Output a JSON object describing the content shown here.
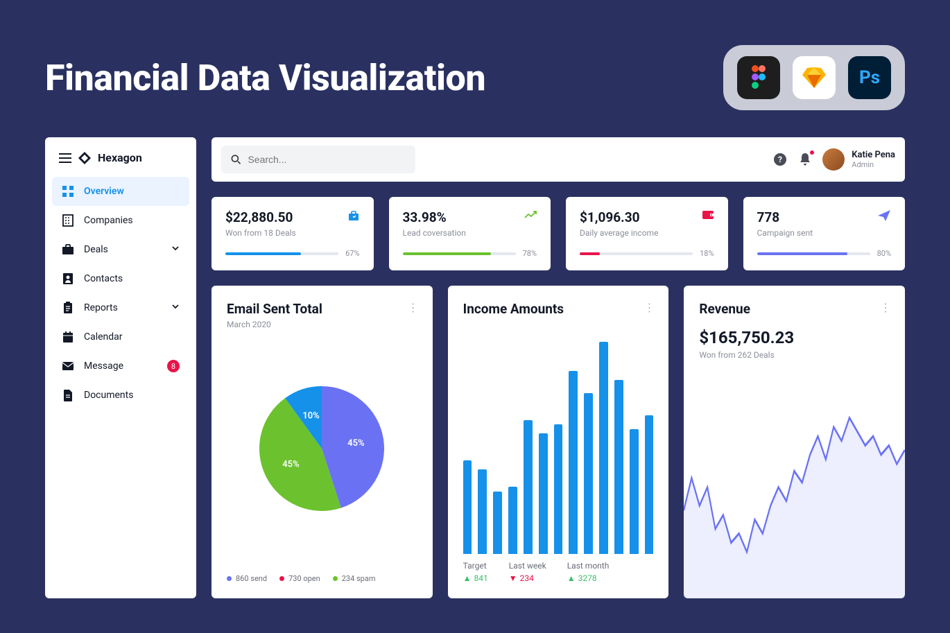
{
  "page_title": "Financial Data Visualization",
  "app_icons": [
    "figma",
    "sketch",
    "photoshop"
  ],
  "brand": "Hexagon",
  "sidebar": [
    {
      "id": "overview",
      "label": "Overview",
      "icon": "dashboard",
      "active": true
    },
    {
      "id": "companies",
      "label": "Companies",
      "icon": "building"
    },
    {
      "id": "deals",
      "label": "Deals",
      "icon": "briefcase",
      "chevron": true
    },
    {
      "id": "contacts",
      "label": "Contacts",
      "icon": "person"
    },
    {
      "id": "reports",
      "label": "Reports",
      "icon": "clipboard",
      "chevron": true
    },
    {
      "id": "calendar",
      "label": "Calendar",
      "icon": "calendar"
    },
    {
      "id": "message",
      "label": "Message",
      "icon": "envelope",
      "badge": 8
    },
    {
      "id": "documents",
      "label": "Documents",
      "icon": "file"
    }
  ],
  "search_placeholder": "Search...",
  "user": {
    "name": "Katie Pena",
    "role": "Admin"
  },
  "kpis": [
    {
      "value": "$22,880.50",
      "sub": "Won from 18 Deals",
      "pct": "67%",
      "progress": 67,
      "color": "#1591ea",
      "icon": "briefcase"
    },
    {
      "value": "33.98%",
      "sub": "Lead coversation",
      "pct": "78%",
      "progress": 78,
      "color": "#6bc22e",
      "icon": "trend-up"
    },
    {
      "value": "$1,096.30",
      "sub": "Daily average income",
      "pct": "18%",
      "progress": 18,
      "color": "#e9134a",
      "icon": "wallet"
    },
    {
      "value": "778",
      "sub": "Campaign sent",
      "pct": "80%",
      "progress": 80,
      "color": "#6a72f3",
      "icon": "send"
    }
  ],
  "email_card": {
    "title": "Email Sent Total",
    "subtitle": "March 2020",
    "legend": [
      {
        "color": "#6a72f3",
        "label": "860 send"
      },
      {
        "color": "#e9134a",
        "label": "730 open"
      },
      {
        "color": "#6bc22e",
        "label": "234 spam"
      }
    ]
  },
  "income_card": {
    "title": "Income Amounts",
    "legend": [
      {
        "label": "Target",
        "value": "841",
        "dir": "up",
        "color": "#3bbf6b"
      },
      {
        "label": "Last week",
        "value": "234",
        "dir": "down",
        "color": "#e9134a"
      },
      {
        "label": "Last month",
        "value": "3278",
        "dir": "up",
        "color": "#3bbf6b"
      }
    ]
  },
  "revenue_card": {
    "title": "Revenue",
    "value": "$165,750.23",
    "sub": "Won from 262 Deals"
  },
  "chart_data": [
    {
      "type": "pie",
      "title": "Email Sent Total",
      "slices": [
        {
          "label": "45%",
          "value": 45,
          "color": "#6a72f3"
        },
        {
          "label": "45%",
          "value": 45,
          "color": "#6bc22e"
        },
        {
          "label": "10%",
          "value": 10,
          "color": "#1591ea"
        }
      ]
    },
    {
      "type": "bar",
      "title": "Income Amounts",
      "values": [
        42,
        38,
        28,
        30,
        60,
        54,
        58,
        82,
        72,
        95,
        78,
        56,
        62
      ],
      "ylim": [
        0,
        100
      ],
      "color": "#1591ea"
    },
    {
      "type": "line",
      "title": "Revenue",
      "values": [
        38,
        52,
        40,
        48,
        30,
        36,
        24,
        28,
        20,
        34,
        28,
        40,
        48,
        42,
        55,
        50,
        62,
        70,
        60,
        74,
        68,
        78,
        72,
        66,
        70,
        62,
        66,
        58,
        64
      ],
      "ylim": [
        0,
        100
      ],
      "color": "#6a72f3"
    }
  ]
}
